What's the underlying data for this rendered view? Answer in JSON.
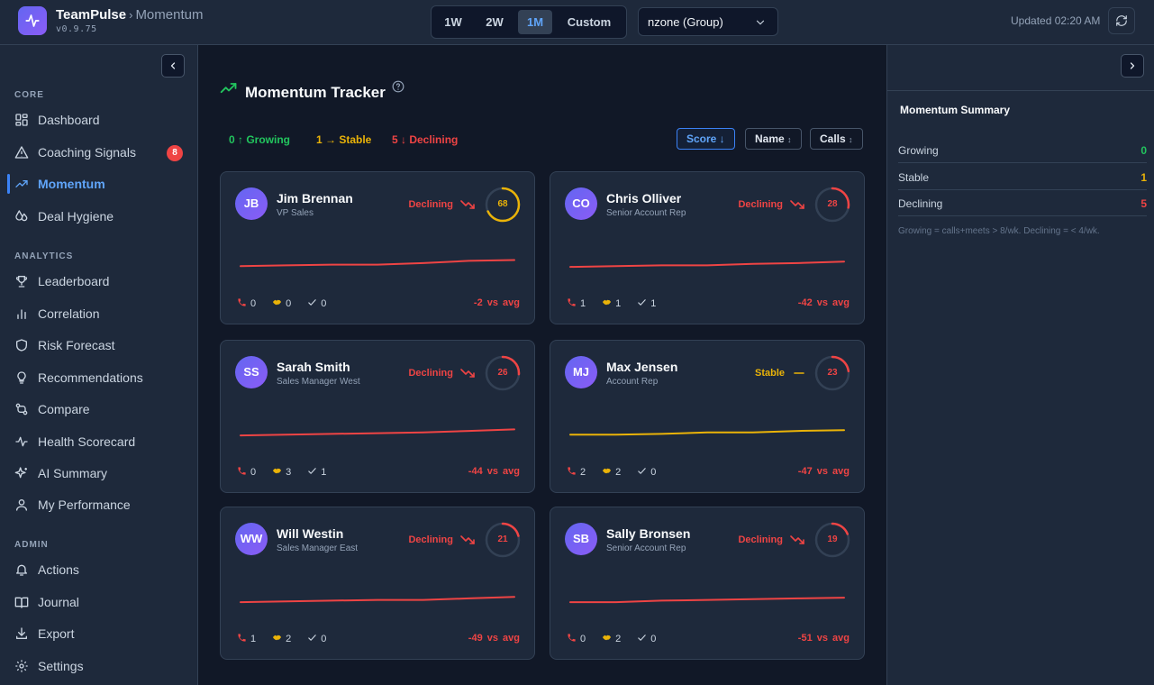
{
  "app": {
    "name": "TeamPulse",
    "separator": "›",
    "section": "Momentum",
    "version": "v0.9.75"
  },
  "range": {
    "options": [
      "1W",
      "2W",
      "1M",
      "Custom"
    ],
    "active": "1M"
  },
  "group_select": {
    "value": "nzone (Group)"
  },
  "updated": "Updated 02:20 AM",
  "sidebar": {
    "sections": [
      {
        "title": "CORE",
        "items": [
          {
            "label": "Dashboard",
            "icon": "dashboard-icon"
          },
          {
            "label": "Coaching Signals",
            "icon": "warning-icon",
            "badge": "8"
          },
          {
            "label": "Momentum",
            "icon": "trending-icon",
            "active": true
          },
          {
            "label": "Deal Hygiene",
            "icon": "droplets-icon"
          }
        ]
      },
      {
        "title": "ANALYTICS",
        "items": [
          {
            "label": "Leaderboard",
            "icon": "trophy-icon"
          },
          {
            "label": "Correlation",
            "icon": "bar-chart-icon"
          },
          {
            "label": "Risk Forecast",
            "icon": "shield-icon"
          },
          {
            "label": "Recommendations",
            "icon": "lightbulb-icon"
          },
          {
            "label": "Compare",
            "icon": "compare-icon"
          },
          {
            "label": "Health Scorecard",
            "icon": "activity-icon"
          },
          {
            "label": "AI Summary",
            "icon": "sparkles-icon"
          },
          {
            "label": "My Performance",
            "icon": "user-icon"
          }
        ]
      },
      {
        "title": "ADMIN",
        "items": [
          {
            "label": "Actions",
            "icon": "bell-icon"
          },
          {
            "label": "Journal",
            "icon": "book-icon"
          },
          {
            "label": "Export",
            "icon": "download-icon"
          },
          {
            "label": "Settings",
            "icon": "gear-icon"
          }
        ]
      }
    ]
  },
  "main": {
    "title": "Momentum Tracker",
    "summary": {
      "growing": "0 ↑ Growing",
      "stable": "1 → Stable",
      "declining": "5 ↓ Declining"
    },
    "sort": {
      "score": "Score ↓",
      "name": "Name",
      "calls": "Calls",
      "both_arrow": "↕"
    },
    "colors": {
      "growing": "#22c55e",
      "stable": "#eab308",
      "declining": "#ef4444"
    },
    "cards": [
      {
        "initials": "JB",
        "name": "Jim Brennan",
        "role": "VP Sales",
        "trend": "Declining",
        "trend_kind": "declining",
        "score": 68,
        "calls": "0",
        "meets": "0",
        "tasks": "0",
        "vs_avg": "-2  vs  avg",
        "spark": [
          2,
          3,
          4,
          4,
          6,
          9,
          10
        ]
      },
      {
        "initials": "CO",
        "name": "Chris Olliver",
        "role": "Senior Account Rep",
        "trend": "Declining",
        "trend_kind": "declining",
        "score": 28,
        "calls": "1",
        "meets": "1",
        "tasks": "1",
        "vs_avg": "-42  vs  avg",
        "spark": [
          1,
          2,
          3,
          3,
          5,
          6,
          8
        ]
      },
      {
        "initials": "SS",
        "name": "Sarah Smith",
        "role": "Sales Manager West",
        "trend": "Declining",
        "trend_kind": "declining",
        "score": 26,
        "calls": "0",
        "meets": "3",
        "tasks": "1",
        "vs_avg": "-44  vs  avg",
        "spark": [
          1,
          2,
          3,
          4,
          5,
          7,
          9
        ]
      },
      {
        "initials": "MJ",
        "name": "Max Jensen",
        "role": "Account Rep",
        "trend": "Stable",
        "trend_kind": "stable",
        "score": 23,
        "calls": "2",
        "meets": "2",
        "tasks": "0",
        "vs_avg": "-47  vs  avg",
        "spark": [
          2,
          2,
          3,
          5,
          5,
          7,
          8
        ]
      },
      {
        "initials": "WW",
        "name": "Will Westin",
        "role": "Sales Manager East",
        "trend": "Declining",
        "trend_kind": "declining",
        "score": 21,
        "calls": "1",
        "meets": "2",
        "tasks": "0",
        "vs_avg": "-49  vs  avg",
        "spark": [
          1,
          2,
          3,
          4,
          4,
          6,
          8
        ]
      },
      {
        "initials": "SB",
        "name": "Sally Bronsen",
        "role": "Senior Account Rep",
        "trend": "Declining",
        "trend_kind": "declining",
        "score": 19,
        "calls": "0",
        "meets": "2",
        "tasks": "0",
        "vs_avg": "-51  vs  avg",
        "spark": [
          1,
          1,
          3,
          4,
          5,
          6,
          7
        ]
      }
    ]
  },
  "right_panel": {
    "title": "Momentum Summary",
    "rows": [
      {
        "label": "Growing",
        "value": "0",
        "kind": "growing"
      },
      {
        "label": "Stable",
        "value": "1",
        "kind": "stable"
      },
      {
        "label": "Declining",
        "value": "5",
        "kind": "declining"
      }
    ],
    "note": "Growing = calls+meets > 8/wk. Declining = < 4/wk."
  }
}
